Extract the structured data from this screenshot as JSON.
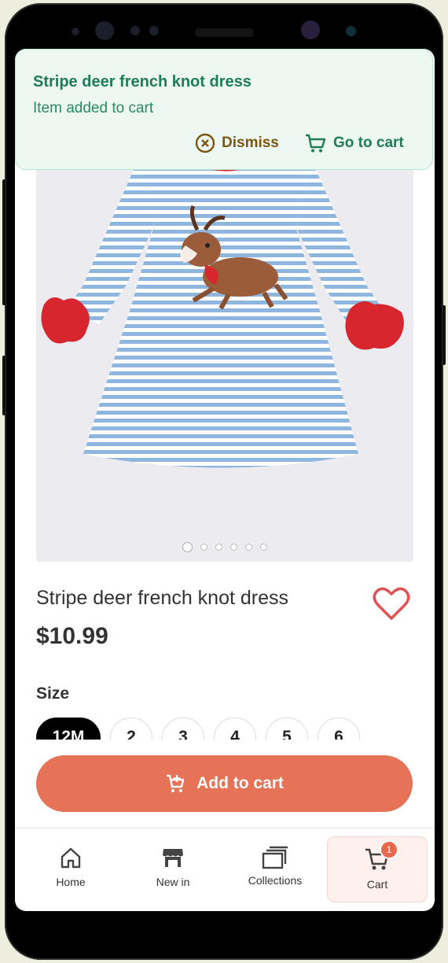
{
  "toast": {
    "title": "Stripe deer french knot dress",
    "message": "Item added to cart",
    "dismiss_label": "Dismiss",
    "go_to_cart_label": "Go to cart"
  },
  "product": {
    "title": "Stripe deer french knot dress",
    "price": "$10.99",
    "image_count": 6,
    "active_image_index": 0
  },
  "size": {
    "label": "Size",
    "options": [
      "12M",
      "2",
      "3",
      "4",
      "5",
      "6"
    ],
    "selected": "12M"
  },
  "add_to_cart_label": "Add to cart",
  "nav": {
    "items": [
      {
        "label": "Home",
        "icon": "home-icon"
      },
      {
        "label": "New in",
        "icon": "store-icon"
      },
      {
        "label": "Collections",
        "icon": "collections-icon"
      },
      {
        "label": "Cart",
        "icon": "cart-icon"
      }
    ],
    "active": "Cart",
    "cart_badge": "1"
  },
  "colors": {
    "accent": "#e67357",
    "toast_bg": "#edf8f3",
    "toast_title": "#1f7d55",
    "dismiss": "#7a5610",
    "heart": "#e05252",
    "badge": "#e8694d"
  }
}
